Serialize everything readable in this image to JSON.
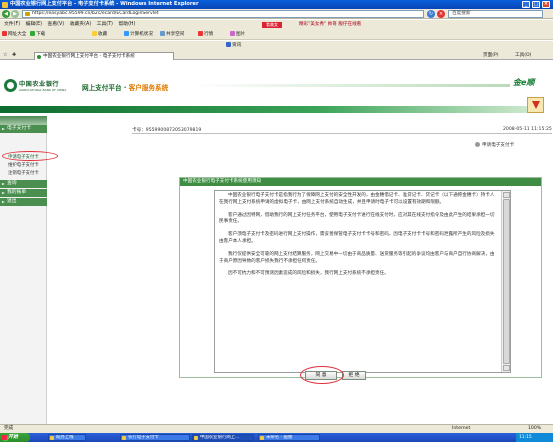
{
  "window": {
    "title": "中国农业银行网上支付平台 - 电子支付卡系统 - Windows Internet Explorer",
    "buttons": [
      "_",
      "□",
      "×"
    ]
  },
  "address": {
    "url": "https://easyabc.95599.cn/b2c/ecard/ECardLoginServlet",
    "search_placeholder": "百度搜索"
  },
  "menu": {
    "items": [
      "文件(F)",
      "编辑(E)",
      "查看(V)",
      "收藏夹(A)",
      "工具(T)",
      "帮助(H)"
    ],
    "ad_badge": "看美女",
    "ad_text": "精彩\"美女秀\" 帅哥 靓仔在线看"
  },
  "toolbar": {
    "brand": "网址大全",
    "download": "下载",
    "favorites": "收藏",
    "computer_status": "计算机状况",
    "share": "共享空间",
    "pictures": "图片",
    "news": "资讯",
    "stocks": "行情"
  },
  "tab": {
    "label": "中国农业银行网上支付平台 - 电子支付卡系统",
    "right_page": "页面(P)",
    "right_tools": "工具(O)"
  },
  "banner": {
    "bank_name": "中国农业银行",
    "bank_en": "AGRICULTURAL BANK OF CHINA",
    "system_title_prefix": "网上支付平台 · ",
    "system_title_suffix": "客户服务系统",
    "brand": "金e顺"
  },
  "sidebar": {
    "sections": [
      {
        "label": "电子支付卡"
      },
      {
        "label": "查询"
      },
      {
        "label": "我的账单"
      },
      {
        "label": "退出"
      }
    ],
    "items": [
      {
        "label": "申请电子支付卡"
      },
      {
        "label": "维护电子支付卡"
      },
      {
        "label": "注销电子支付卡"
      }
    ]
  },
  "main": {
    "card_number": "卡号：9559900872053079819",
    "datetime": "2008-05-11 11:15:25",
    "right_link": "申请电子支付卡",
    "panel_title": "中国农业银行电子支付卡系统使用须知",
    "agreement": [
      "中国农业银行电子支付卡是指我行为了保障网上支付的安全性开发的，由金穗借记卡、准贷记卡、贷记卡（以下通称金穗卡）持卡人在我行网上支付系统申请的虚拟电子卡，由网上支付系统自动生成，并且申请时电子卡可以设置有效期和限额。",
      "客户通过因特网，借助我行的网上支付任务平台，使用电子支付卡进行在线支付时，应对其在线支付指令及由此产生的结果承担一切民事责任。",
      "客户须电子支付卡及密码进行网上支付操作，需妥善保管电子支付卡卡号和密码，因电子支付卡卡号和密码泄露所产生的风险及损失由客户本人承担。",
      "我行仅提供安全可靠的网上支付结算服务，网上交易中一切由于商品质量、送货服务等引起的争议均由客户与商户自行协商解决，由于商户原因导致的客户损失我行不承担任何责任。",
      "因不可抗力和不可预测因素造成的风险和损失，我行网上支付系统不承担责任。"
    ],
    "agree_button": "同 意",
    "decline_button": "拒 绝"
  },
  "statusbar": {
    "status": "完成",
    "zone": "Internet",
    "zoom": "100%"
  },
  "taskbar": {
    "start": "开始",
    "tasks": [
      "既办上线",
      "农行电子支付卡",
      "中国农业银行网上...",
      "未命名 - 画图"
    ],
    "clock": "11:15"
  }
}
